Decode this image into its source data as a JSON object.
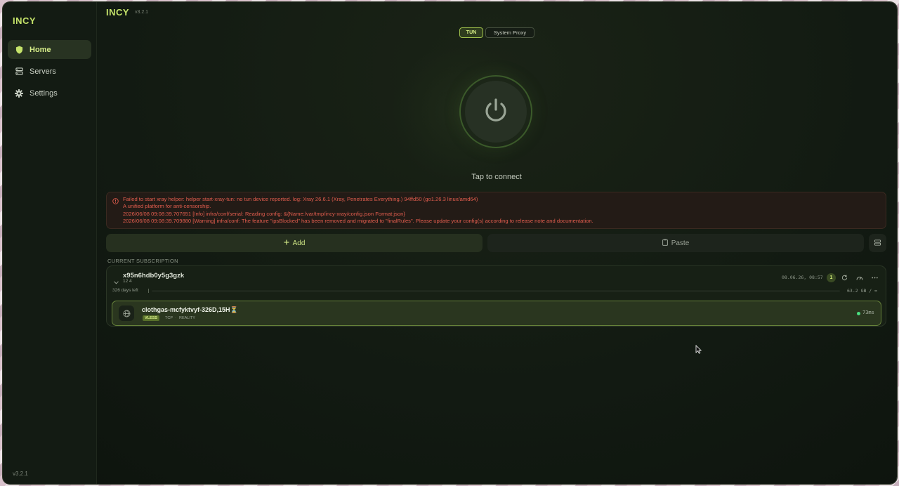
{
  "app": {
    "name": "INCY",
    "version": "v3.2.1"
  },
  "sidebar": {
    "brand": "INCY",
    "items": [
      {
        "label": "Home",
        "icon": "shield-icon",
        "active": true
      },
      {
        "label": "Servers",
        "icon": "server-icon",
        "active": false
      },
      {
        "label": "Settings",
        "icon": "gear-icon",
        "active": false
      }
    ],
    "version": "v3.2.1"
  },
  "header": {
    "title": "INCY",
    "version": "v3.2.1"
  },
  "mode": {
    "options": [
      "TUN",
      "System Proxy"
    ],
    "selected": "TUN"
  },
  "power": {
    "icon": "power-icon",
    "caption": "Tap to connect"
  },
  "error": {
    "icon": "alert-circle-icon",
    "color": "#e25d4e",
    "lines": [
      "Failed to start xray helper: helper start-xray-tun: no tun device reported. log: Xray 26.6.1 (Xray, Penetrates Everything.) 94ffd50 (go1.26.3 linux/amd64)",
      "A unified platform for anti-censorship.",
      "2026/06/08 09:08:39.707651 [Info] infra/conf/serial: Reading config: &{Name:/var/tmp/incy-xray/config.json Format:json}",
      "2026/06/08 09:08:39.709880 [Warning] infra/conf: The feature \"ipsBlocked\" has been removed and migrated to \"finalRules\". Please update your config(s) according to release note and documentation."
    ]
  },
  "actions": {
    "add_label": "Add",
    "add_icon": "plus-icon",
    "paste_label": "Paste",
    "paste_icon": "clipboard-icon",
    "extra_icon": "list-icon"
  },
  "subscription": {
    "section_label": "CURRENT SUBSCRIPTION",
    "name": "x95n6hdb0y5g3gzk",
    "meta": "12 4",
    "updated": "08.06.26, 08:57",
    "badge": "1",
    "days_left": "326 days left",
    "usage": "63.2 GB / ∞",
    "usage_fraction": 0.0,
    "icons": [
      "refresh-icon",
      "gauge-icon",
      "more-icon"
    ]
  },
  "server": {
    "name": "clothgas-mcfyktvyf-326D,15H⏳",
    "protocol": "VLESS",
    "transport": "TCP",
    "separator": "·",
    "security": "REALITY",
    "latency": "73ms",
    "latency_color": "#4ade80",
    "accent": "#c5e36a"
  }
}
